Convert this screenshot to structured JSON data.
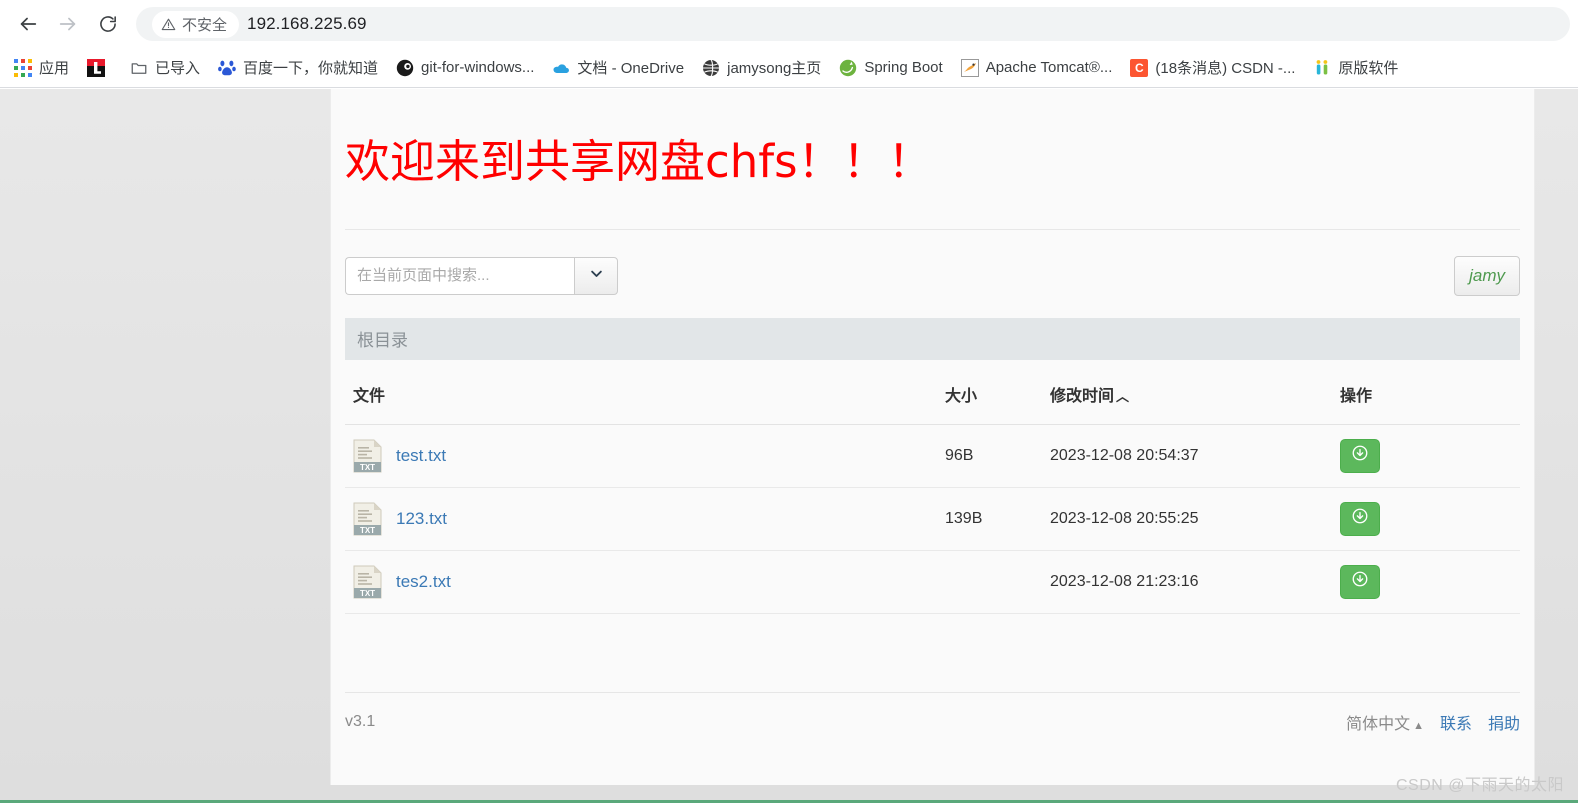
{
  "browser": {
    "nav": {
      "back_label": "Back",
      "forward_label": "Forward",
      "reload_label": "Reload"
    },
    "omnibox": {
      "security_label": "不安全",
      "url": "192.168.225.69"
    },
    "bookmarks": [
      {
        "label": "应用",
        "icon": "apps-grid-icon"
      },
      {
        "label": "",
        "icon": "lanzou-icon"
      },
      {
        "label": "已导入",
        "icon": "folder-icon"
      },
      {
        "label": "百度一下，你就知道",
        "icon": "baidu-icon"
      },
      {
        "label": "git-for-windows...",
        "icon": "git-icon"
      },
      {
        "label": "文档 - OneDrive",
        "icon": "onedrive-icon"
      },
      {
        "label": "jamysong主页",
        "icon": "globe-icon"
      },
      {
        "label": "Spring Boot",
        "icon": "spring-icon"
      },
      {
        "label": "Apache Tomcat®...",
        "icon": "tomcat-icon"
      },
      {
        "label": "(18条消息) CSDN -...",
        "icon": "csdn-icon"
      },
      {
        "label": "原版软件",
        "icon": "yuanban-icon"
      }
    ]
  },
  "site": {
    "title": "欢迎来到共享网盘chfs！！！",
    "search": {
      "placeholder": "在当前页面中搜索...",
      "value": "",
      "dropdown_icon": "chevron-down-icon"
    },
    "user_button": "jamy",
    "breadcrumb": "根目录",
    "table": {
      "headers": {
        "file": "文件",
        "size": "大小",
        "time": "修改时间",
        "sort_caret": "︿",
        "action": "操作"
      },
      "rows": [
        {
          "name": "test.txt",
          "icon": "txt-file-icon",
          "size": "96B",
          "time": "2023-12-08 20:54:37",
          "action_icon": "download-icon"
        },
        {
          "name": "123.txt",
          "icon": "txt-file-icon",
          "size": "139B",
          "time": "2023-12-08 20:55:25",
          "action_icon": "download-icon"
        },
        {
          "name": "tes2.txt",
          "icon": "txt-file-icon",
          "size": "",
          "time": "2023-12-08 21:23:16",
          "action_icon": "download-icon"
        }
      ]
    },
    "footer": {
      "version": "v3.1",
      "language": "简体中文",
      "language_caret": "▲",
      "contact": "联系",
      "donate": "捐助"
    }
  },
  "watermark": "CSDN @下雨天的太阳",
  "colors": {
    "title_red": "#ff0000",
    "link_blue": "#3b79b5",
    "download_green": "#5cb85c",
    "user_green": "#4f9a4f",
    "breadcrumb_bg": "#e2e6e8"
  }
}
